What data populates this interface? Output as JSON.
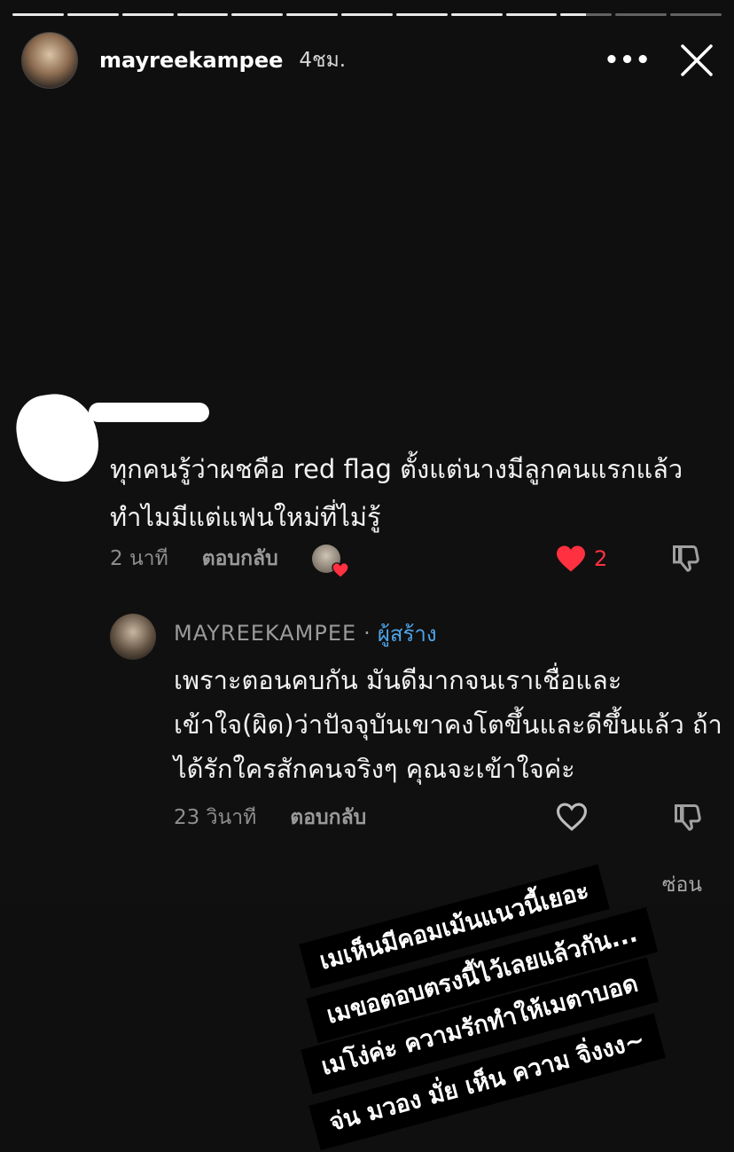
{
  "story": {
    "progress_segments": [
      1,
      1,
      1,
      1,
      1,
      1,
      1,
      1,
      1,
      1,
      0.5,
      0,
      0
    ],
    "header": {
      "username": "mayreekampee",
      "time": "4ชม.",
      "more_icon": "ellipsis-icon",
      "close_icon": "close-icon"
    }
  },
  "comment": {
    "text": "ทุกคนรู้ว่าผชคือ red flag ตั้งแต่นางมีลูกคนแรกแล้ว ทำไมมีแต่แฟนใหม่ที่ไม่รู้",
    "time": "2 นาที",
    "reply_label": "ตอบกลับ",
    "like_count": "2",
    "liked": true,
    "colors": {
      "like": "#ff3040"
    }
  },
  "reply": {
    "username": "MAYREEKAMPEE",
    "separator": "·",
    "creator_label": "ผู้สร้าง",
    "text": "เพราะตอนคบกัน มันดีมากจนเราเชื่อและเข้าใจ(ผิด)ว่าปัจจุบันเขาคงโตขึ้นและดีขึ้นแล้ว ถ้าได้รักใครสักคนจริงๆ คุณจะเข้าใจค่ะ",
    "time": "23 วินาที",
    "reply_label": "ตอบกลับ",
    "colors": {
      "creator": "#4ea3e8"
    }
  },
  "hide_label": "ซ่อน",
  "caption": {
    "lines": [
      "เมเห็นมีคอมเม้นแนวนี้เยอะ",
      "เมขอตอบตรงนี้ไว้เลยแล้วกัน...",
      "เมโง่ค่ะ  ความรักทำให้เมตาบอด",
      "จ่น  มวอง  มั่ย  เห็น  ความ  จิ่งงง~"
    ]
  }
}
